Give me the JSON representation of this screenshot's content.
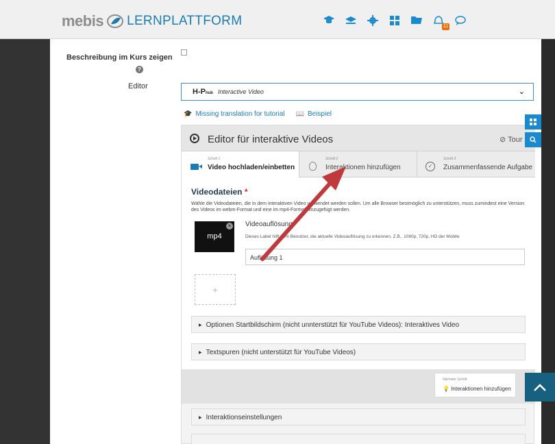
{
  "header": {
    "brand_name": "mebis",
    "brand_sub": "LERNPLATTFORM",
    "notification_count": "11",
    "icons": [
      "graduation-cap-icon",
      "courses-icon",
      "gear-icon",
      "apps-grid-icon",
      "folder-icon",
      "bell-icon",
      "chat-icon"
    ]
  },
  "form": {
    "desc_label": "Beschreibung im Kurs zeigen",
    "help_glyph": "?",
    "editor_label": "Editor",
    "h5p_logo": "H-P",
    "h5p_logo_sub": "hub",
    "library": "Interactive Video",
    "link_tutorial": "Missing translation for tutorial",
    "link_example": "Beispiel"
  },
  "editor": {
    "title": "Editor für interaktive Videos",
    "tour": "Tour",
    "steps": [
      {
        "num": "Schritt 1",
        "label": "Video hochladen/einbetten"
      },
      {
        "num": "Schritt 2",
        "label": "Interaktionen hinzufügen"
      },
      {
        "num": "Schritt 3",
        "label": "Zusammenfassende Aufgabe"
      }
    ],
    "videofiles_title": "Videodateien",
    "required_mark": "*",
    "videofiles_desc": "Wähle die Videodateien, die in dem interaktiven Video verwendet werden sollen. Um alle Browser bestmöglich zu unterstützen, muss zumindest eine Version des Videos im webm-Format und eine im mp4-Format hinzugefügt werden.",
    "file_label": "mp4",
    "res_label": "Videoauflösung",
    "res_desc": "Dieses Label hilft dem Benutzer, die aktuelle Videoauflösung zu erkennen. Z.B.. 1080p, 720p, HD der Mobile",
    "res_value": "Auflösung 1",
    "add_glyph": "+",
    "acc_start": "Optionen Startbildschirm (nicht unnterstützt für YouTube Videos): Interaktives Video",
    "acc_text": "Textspuren (nicht unterstützt für YouTube Videos)",
    "next_label": "Nächster Schritt",
    "next_value": "Interaktionen hinzufügen",
    "acc_interactions": "Interaktionseinstellungen"
  },
  "colors": {
    "accent": "#1a7cb0",
    "arrow": "#c0393d",
    "scroll_top": "#17607f",
    "badge": "#e8700a"
  }
}
